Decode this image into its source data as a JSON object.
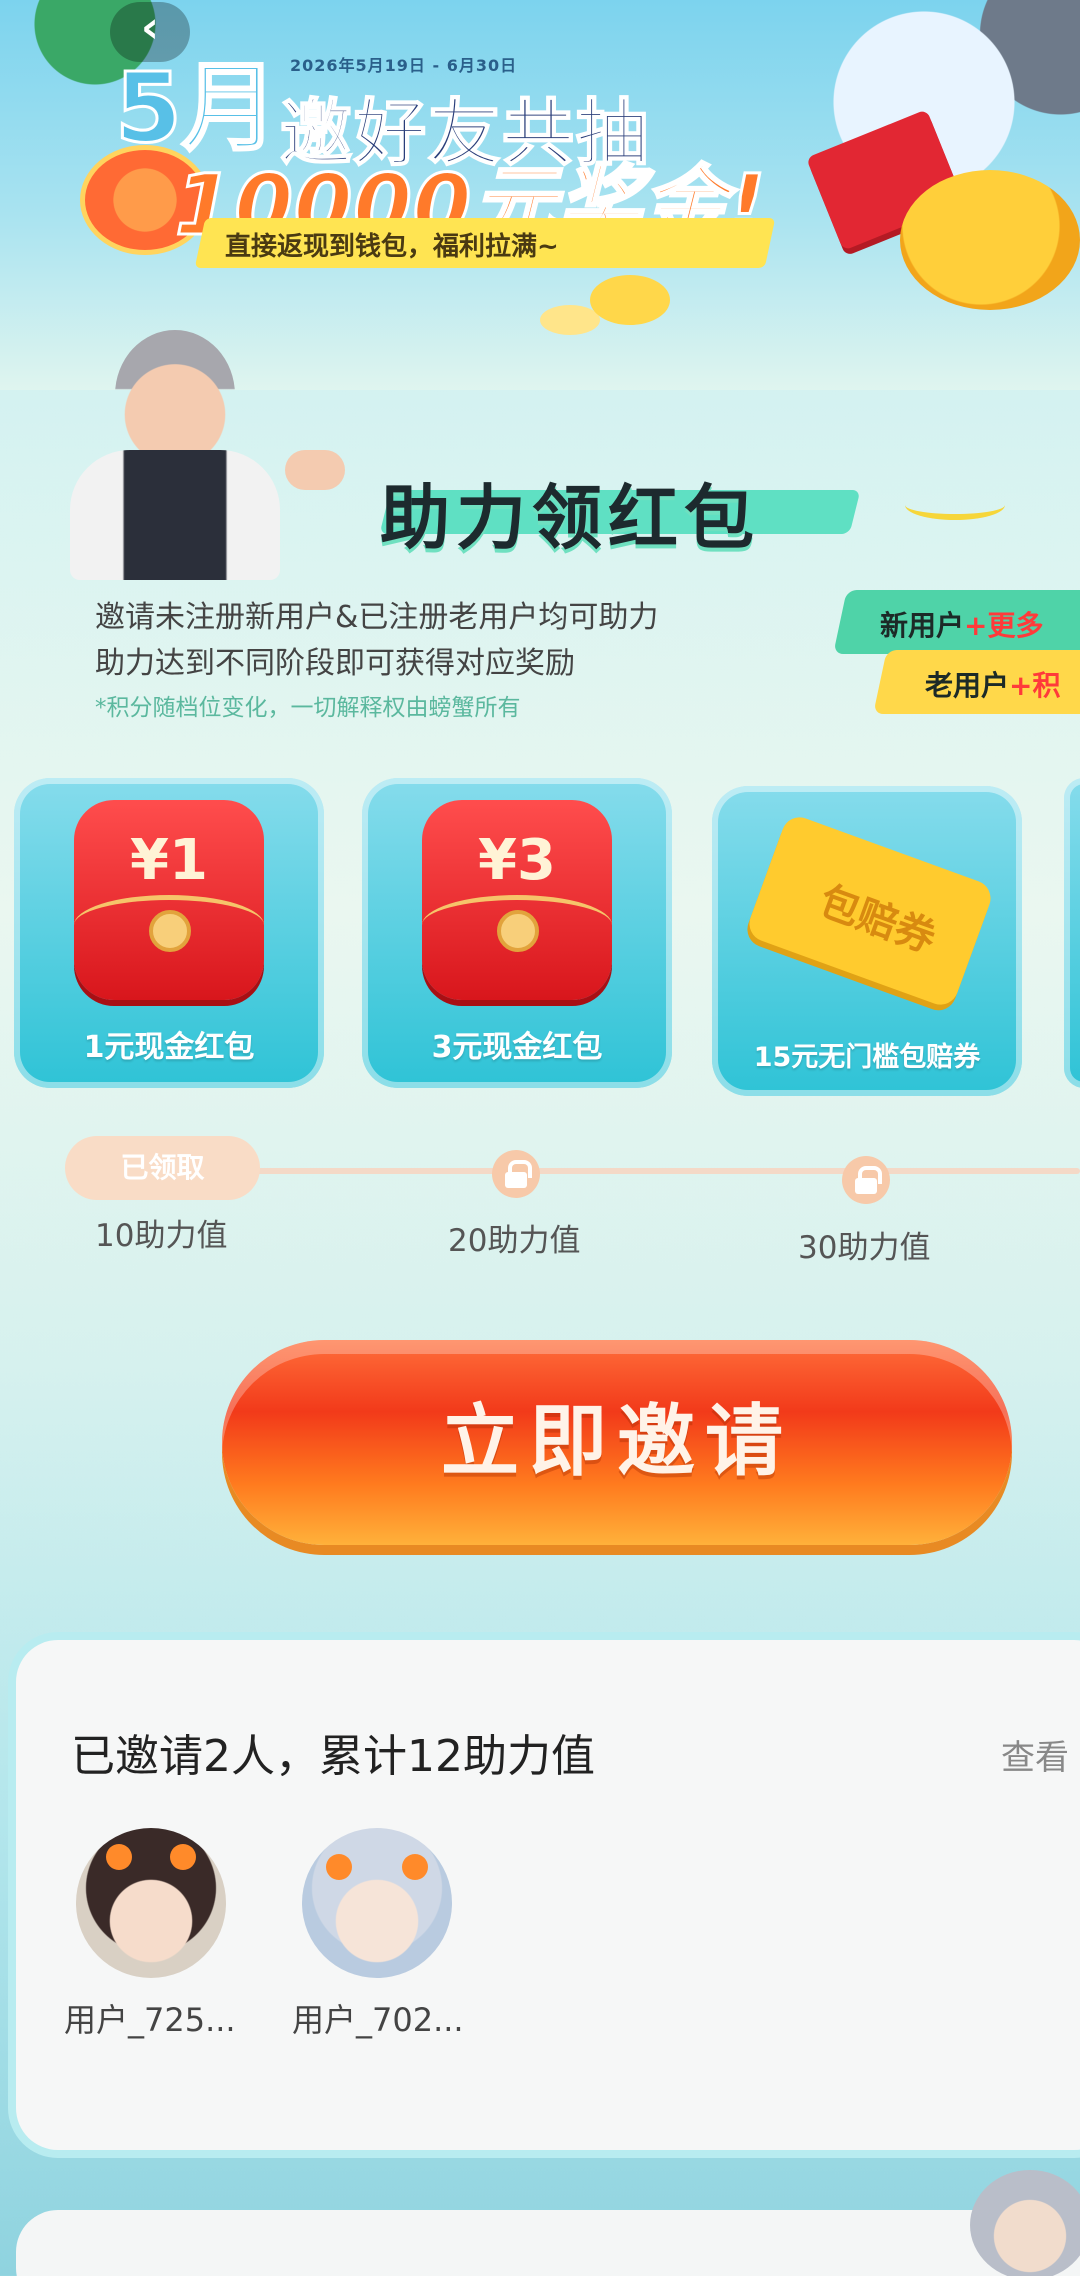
{
  "banner": {
    "date_range": "2026年5月19日 - 6月30日",
    "month": "5月",
    "headline": "邀好友共抽",
    "amount": "10000元奖金!",
    "subline": "直接返现到钱包，福利拉满~",
    "back_glyph": "‹"
  },
  "section": {
    "title": "助力领红包",
    "desc_line1": "邀请未注册新用户&已注册老用户均可助力",
    "desc_line2": "助力达到不同阶段即可获得对应奖励",
    "note": "*积分随档位变化，一切解释权由螃蟹所有",
    "tag_new_prefix": "新用户",
    "tag_new_suffix": "+更多",
    "tag_old_prefix": "老用户",
    "tag_old_suffix": "+积"
  },
  "rewards": [
    {
      "amount": "¥1",
      "label": "1元现金红包"
    },
    {
      "amount": "¥3",
      "label": "3元现金红包"
    },
    {
      "ticket_text": "包赔券",
      "label": "15元无门槛包赔券"
    }
  ],
  "progress": {
    "claimed_label": "已领取",
    "milestones": [
      "10助力值",
      "20助力值",
      "30助力值"
    ]
  },
  "cta": {
    "label": "立即邀请"
  },
  "invited": {
    "title": "已邀请2人，累计12助力值",
    "more": "查看",
    "users": [
      {
        "name": "用户_725..."
      },
      {
        "name": "用户_702..."
      }
    ]
  },
  "colors": {
    "accent_orange": "#ff7a1e",
    "card_teal": "#2ec3d6",
    "envelope_red": "#d8161c"
  }
}
